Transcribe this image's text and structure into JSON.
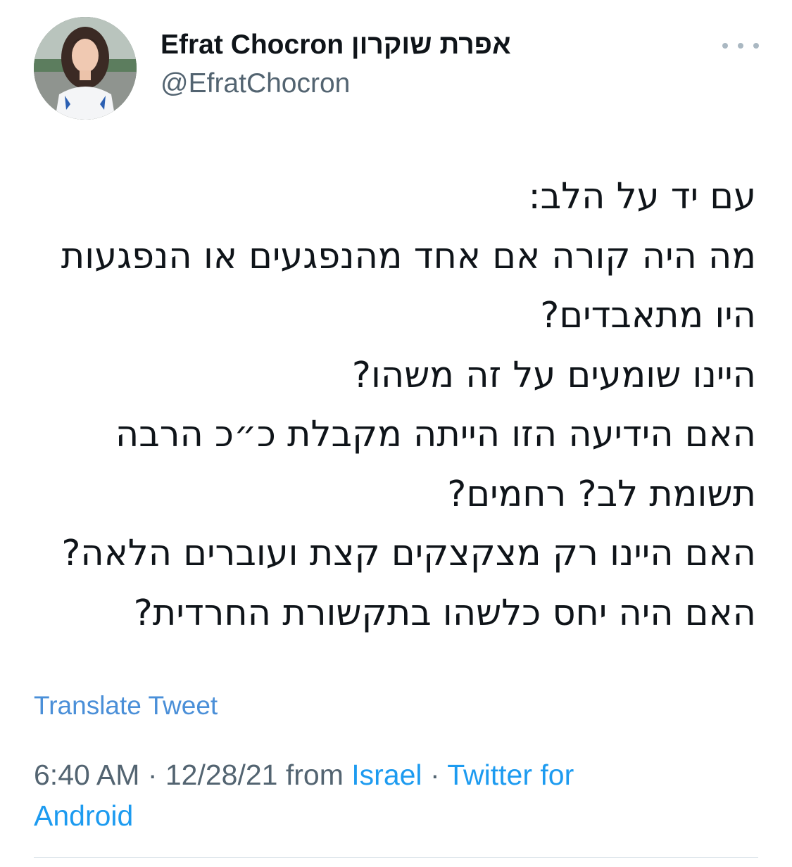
{
  "tweet": {
    "author": {
      "display_name": "Efrat Chocron אפרת שוקרון",
      "handle": "@EfratChocron",
      "avatar_icon": "profile-photo"
    },
    "more_icon": "ellipsis-icon",
    "text": "עם יד על הלב:\nמה היה קורה אם אחד מהנפגעים או הנפגעות היו מתאבדים?\nהיינו שומעים על זה משהו?\nהאם הידיעה הזו הייתה מקבלת כ״כ הרבה תשומת לב? רחמים?\nהאם היינו רק מצקצקים קצת ועוברים הלאה?\nהאם היה יחס כלשהו בתקשורת החרדית?",
    "translate_label": "Translate Tweet",
    "time": "6:40 AM",
    "separator_1": " · ",
    "date": "12/28/21",
    "from_label": " from ",
    "location": "Israel",
    "separator_2": " · ",
    "source": "Twitter for Android"
  },
  "colors": {
    "text": "#0f1419",
    "secondary": "#536471",
    "link": "#1d9bf0",
    "translate_link": "#4a8fd8",
    "divider": "#e1e8ed"
  }
}
